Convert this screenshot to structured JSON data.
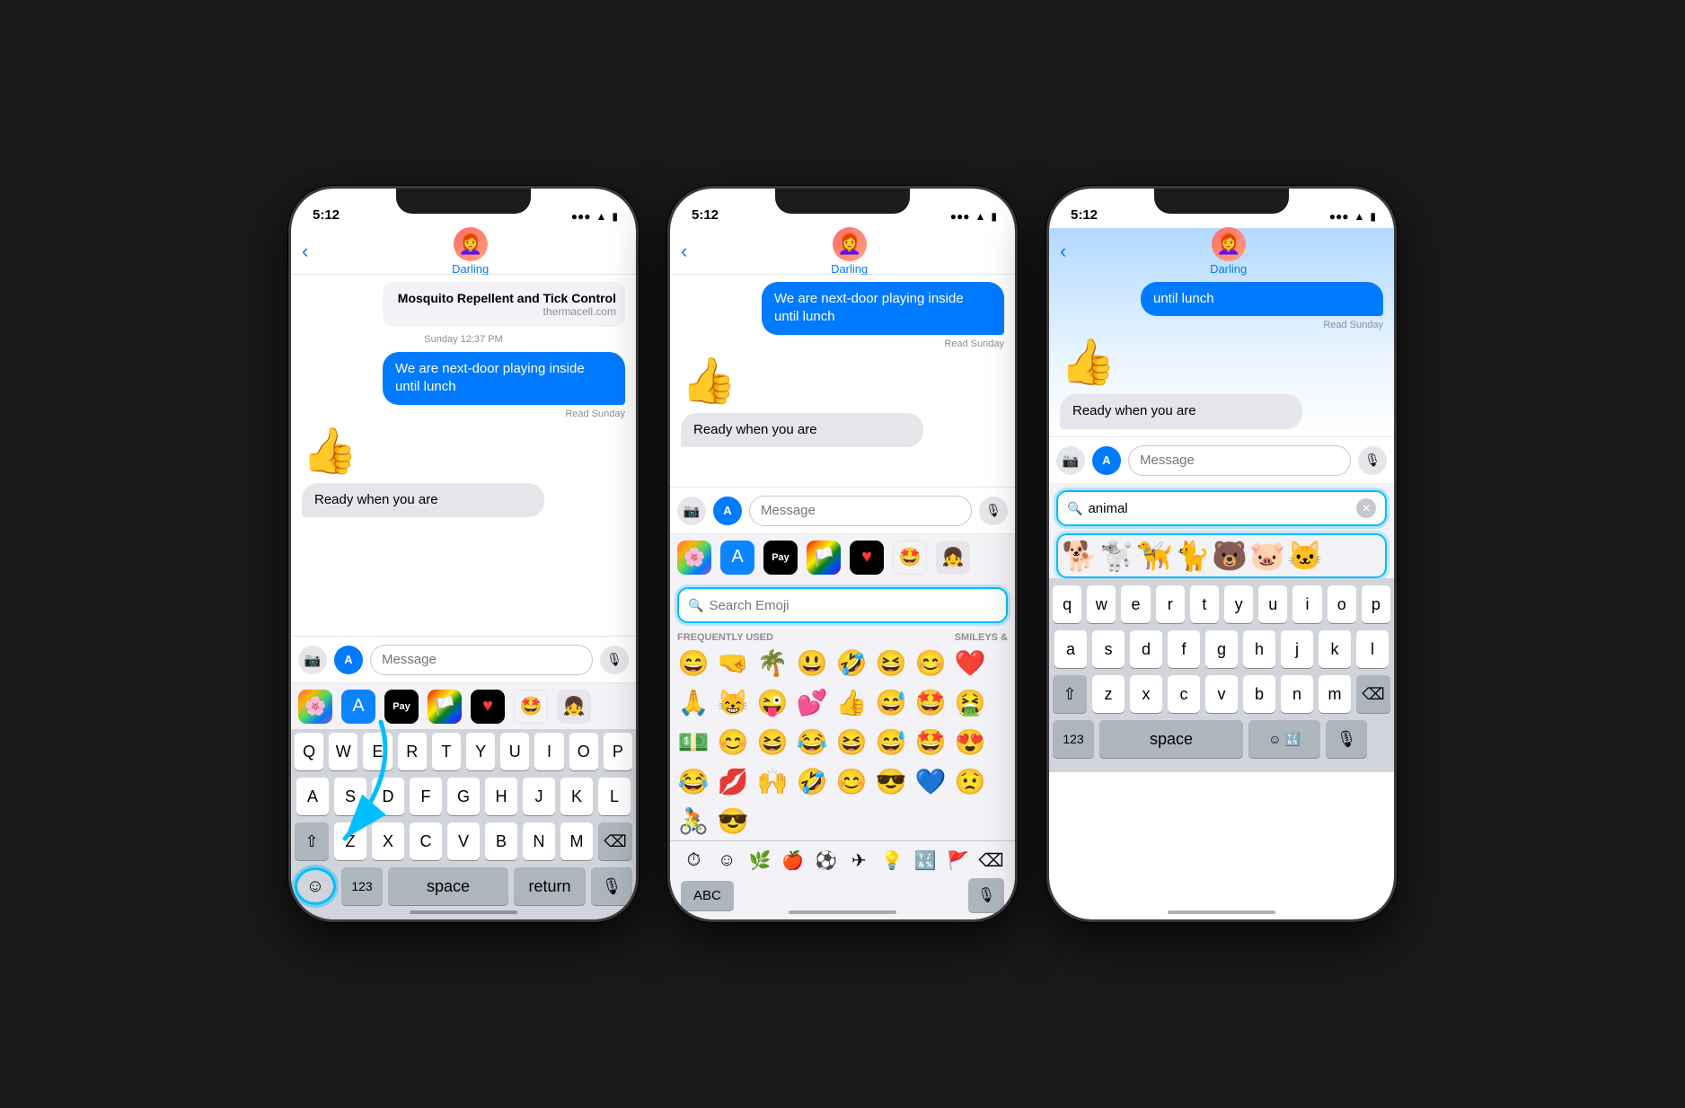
{
  "phones": [
    {
      "id": "phone1",
      "statusBar": {
        "time": "5:12"
      },
      "contact": "Darling",
      "messages": [
        {
          "type": "link-card",
          "title": "Mosquito Repellent and Tick Control",
          "domain": "thermacell.com",
          "side": "sent"
        },
        {
          "type": "timestamp",
          "text": "Sunday 12:37 PM"
        },
        {
          "type": "bubble",
          "text": "We are next-door playing inside until lunch",
          "side": "sent"
        },
        {
          "type": "read",
          "text": "Read Sunday"
        },
        {
          "type": "emoji",
          "text": "👍"
        },
        {
          "type": "bubble",
          "text": "Ready when you are",
          "side": "received"
        }
      ],
      "inputPlaceholder": "Message",
      "hasKeyboard": true,
      "keyboard": {
        "rows": [
          [
            "Q",
            "W",
            "E",
            "R",
            "T",
            "Y",
            "U",
            "I",
            "O",
            "P"
          ],
          [
            "A",
            "S",
            "D",
            "F",
            "G",
            "H",
            "J",
            "K",
            "L"
          ],
          [
            "Z",
            "X",
            "C",
            "V",
            "B",
            "N",
            "M"
          ]
        ],
        "bottomRow": {
          "num": "123",
          "space": "space",
          "return": "return"
        }
      }
    },
    {
      "id": "phone2",
      "statusBar": {
        "time": "5:12"
      },
      "contact": "Darling",
      "messages": [
        {
          "type": "bubble",
          "text": "We are next-door playing inside until lunch",
          "side": "sent"
        },
        {
          "type": "read",
          "text": "Read Sunday"
        },
        {
          "type": "emoji",
          "text": "👍"
        },
        {
          "type": "bubble",
          "text": "Ready when you are",
          "side": "received"
        }
      ],
      "inputPlaceholder": "Message",
      "hasEmojiKeyboard": true,
      "emojiSearch": {
        "placeholder": "Search Emoji"
      },
      "frequentlyUsed": [
        "😄",
        "🤜",
        "🌴",
        "😃",
        "🤣",
        "😆",
        "😊",
        "❤️",
        "🙏",
        "😸",
        "😛",
        "💕",
        "👍",
        "😅",
        "🤩",
        "🤮",
        "💵",
        "😊",
        "😆",
        "😂",
        "😆",
        "😅",
        "🤩",
        "😍",
        "😂",
        "💋",
        "🙌",
        "🤣",
        "😊",
        "😎",
        "💙",
        "😟",
        "🚴"
      ],
      "sectionLabels": [
        "FREQUENTLY USED",
        "SMILEYS &"
      ]
    },
    {
      "id": "phone3",
      "statusBar": {
        "time": "5:12"
      },
      "contact": "Darling",
      "messages": [
        {
          "type": "bubble-partial",
          "text": "until lunch",
          "side": "sent"
        },
        {
          "type": "read",
          "text": "Read Sunday"
        },
        {
          "type": "emoji",
          "text": "👍"
        },
        {
          "type": "bubble",
          "text": "Ready when you are",
          "side": "received"
        }
      ],
      "inputPlaceholder": "Message",
      "hasAnimalSearch": true,
      "animalSearch": {
        "value": "animal",
        "results": [
          "🐕",
          "🐩",
          "🦮",
          "🐈",
          "🐻",
          "🐷",
          "🐱"
        ]
      },
      "keyboard": {
        "rows": [
          [
            "q",
            "w",
            "e",
            "r",
            "t",
            "y",
            "u",
            "i",
            "o",
            "p"
          ],
          [
            "a",
            "s",
            "d",
            "f",
            "g",
            "h",
            "j",
            "k",
            "l"
          ],
          [
            "z",
            "x",
            "c",
            "v",
            "b",
            "n",
            "m"
          ]
        ],
        "bottomRow": {
          "num": "123",
          "space": "space",
          "emoji": "☺"
        }
      }
    }
  ],
  "arrows": {
    "phone1": {
      "fromLabel": "emoji button",
      "toLabel": "keyboard bottom-left"
    }
  }
}
